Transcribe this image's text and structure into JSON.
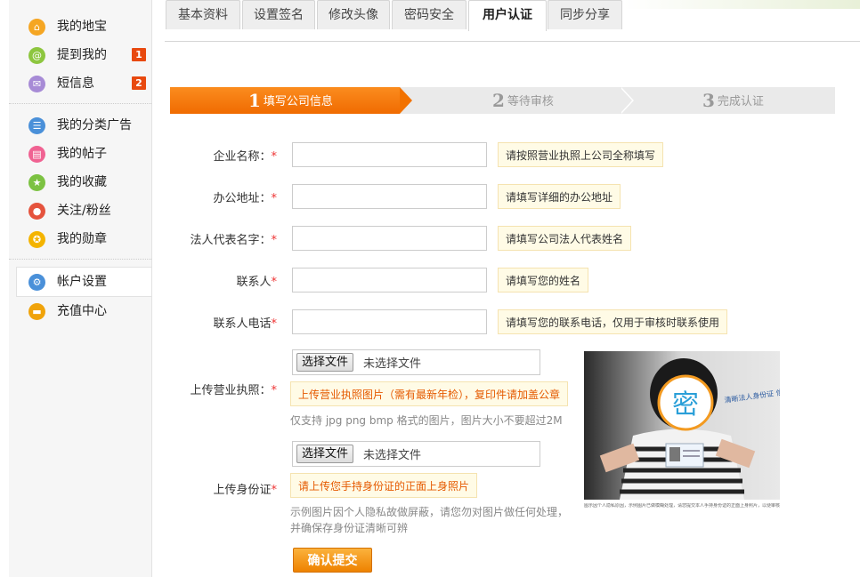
{
  "sidebar": {
    "group1": [
      {
        "label": "我的地宝",
        "icon": "home-icon",
        "color": "#f5a623",
        "glyph": "⌂"
      },
      {
        "label": "提到我的",
        "icon": "at-icon",
        "color": "#8dc63f",
        "glyph": "@",
        "badge": "1"
      },
      {
        "label": "短信息",
        "icon": "envelope-icon",
        "color": "#a78bd6",
        "glyph": "✉",
        "badge": "2"
      }
    ],
    "group2": [
      {
        "label": "我的分类广告",
        "icon": "list-icon",
        "color": "#4a90d9",
        "glyph": "☰"
      },
      {
        "label": "我的帖子",
        "icon": "document-icon",
        "color": "#f06292",
        "glyph": "▤"
      },
      {
        "label": "我的收藏",
        "icon": "star-icon",
        "color": "#7cc242",
        "glyph": "★"
      },
      {
        "label": "关注/粉丝",
        "icon": "users-icon",
        "color": "#e5533d",
        "glyph": "●"
      },
      {
        "label": "我的勋章",
        "icon": "medal-icon",
        "color": "#f4b400",
        "glyph": "✪"
      }
    ],
    "group3": [
      {
        "label": "帐户设置",
        "icon": "gear-icon",
        "color": "#4a90d9",
        "glyph": "⚙"
      },
      {
        "label": "充值中心",
        "icon": "wallet-icon",
        "color": "#f0a30a",
        "glyph": "▬"
      }
    ]
  },
  "tabs": [
    "基本资料",
    "设置签名",
    "修改头像",
    "密码安全",
    "用户认证",
    "同步分享"
  ],
  "active_tab": "用户认证",
  "steps": [
    {
      "num": "1",
      "label": "填写公司信息"
    },
    {
      "num": "2",
      "label": "等待审核"
    },
    {
      "num": "3",
      "label": "完成认证"
    }
  ],
  "form": {
    "company_name": {
      "label": "企业名称：",
      "hint": "请按照营业执照上公司全称填写"
    },
    "office_address": {
      "label": "办公地址：",
      "hint": "请填写详细的办公地址"
    },
    "legal_rep": {
      "label": "法人代表名字：",
      "hint": "请填写公司法人代表姓名"
    },
    "contact": {
      "label": "联系人",
      "hint": "请填写您的姓名"
    },
    "contact_phone": {
      "label": "联系人电话",
      "hint": "请填写您的联系电话，仅用于审核时联系使用"
    },
    "license_upload": {
      "label": "上传营业执照：",
      "button": "选择文件",
      "status": "未选择文件",
      "hint": "上传营业执照图片（需有最新年检），复印件请加盖公章",
      "note": "仅支持 jpg png bmp 格式的图片，图片大小不要超过2M"
    },
    "id_upload": {
      "label": "上传身份证",
      "button": "选择文件",
      "status": "未选择文件",
      "hint": "请上传您手持身份证的正面上身照片",
      "note_line1": "示例图片因个人隐私故做屏蔽，请您勿对图片做任何处理，",
      "note_line2": "并确保存身份证清晰可辨"
    },
    "required_mark": "*",
    "submit": "确认提交"
  },
  "example_photo": {
    "overlay_char": "密",
    "handwriting": "清晰法人身份证 信息清晰可辨",
    "caption": "图示因个人隐私原因，示例图片已做模糊处理，请您提交本人手持身份证的正面上身照片，以便审核。"
  }
}
